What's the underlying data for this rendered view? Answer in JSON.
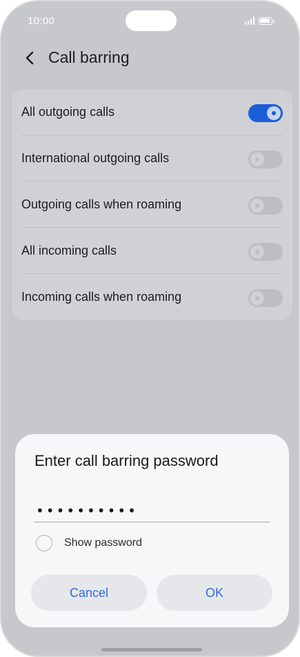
{
  "status_bar": {
    "time": "10:00"
  },
  "header": {
    "title": "Call barring"
  },
  "settings": {
    "items": [
      {
        "label": "All outgoing calls",
        "enabled": true
      },
      {
        "label": "International outgoing calls",
        "enabled": false
      },
      {
        "label": "Outgoing calls when roaming",
        "enabled": false
      },
      {
        "label": "All incoming calls",
        "enabled": false
      },
      {
        "label": "Incoming calls when roaming",
        "enabled": false
      }
    ]
  },
  "dialog": {
    "title": "Enter call barring password",
    "password_value": "••••••••••",
    "show_password_label": "Show password",
    "show_password_checked": false,
    "cancel_label": "Cancel",
    "ok_label": "OK"
  },
  "colors": {
    "accent": "#1b5fd8",
    "button_text": "#2f6ae0"
  }
}
